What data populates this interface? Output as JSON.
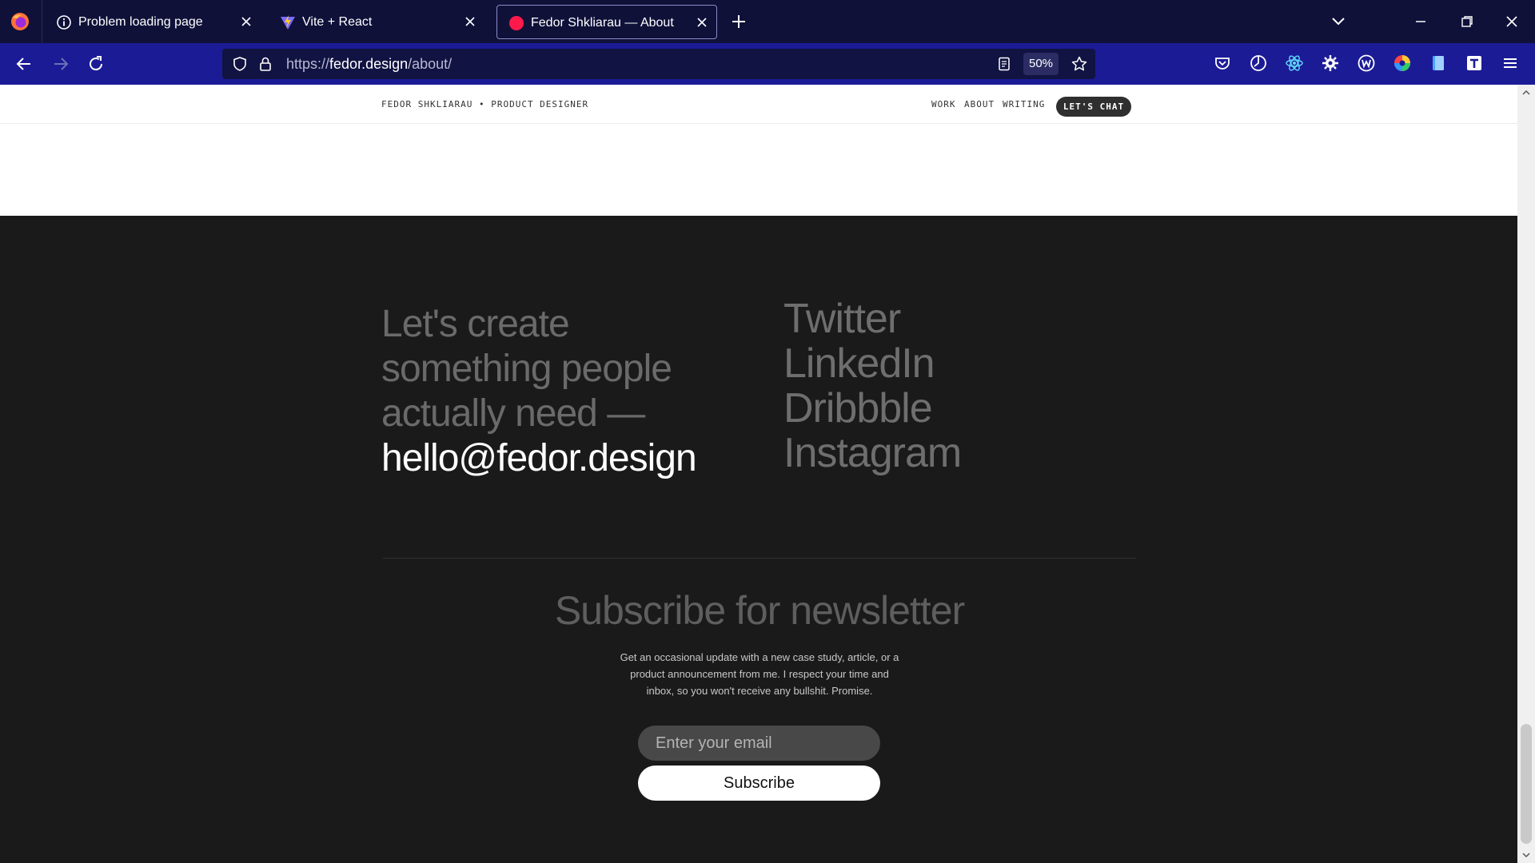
{
  "browser": {
    "tabs": [
      {
        "title": "Problem loading page",
        "icon": "info-icon",
        "active": false
      },
      {
        "title": "Vite + React",
        "icon": "vite-icon",
        "active": false
      },
      {
        "title": "Fedor Shkliarau — About",
        "icon": "favicon-dot-icon",
        "active": true
      }
    ],
    "url": {
      "scheme": "https://",
      "host": "fedor.design",
      "path": "/about/"
    },
    "zoom": "50%",
    "accent": "#1c1b96",
    "tabbar_color": "#0f1139"
  },
  "site": {
    "brand": "FEDOR SHKLIARAU • PRODUCT DESIGNER",
    "nav": [
      "WORK",
      "ABOUT",
      "WRITING"
    ],
    "cta_button": "LET'S CHAT"
  },
  "footer": {
    "cta_line1": "Let's create",
    "cta_line2": "something people",
    "cta_line3": "actually need —",
    "email": "hello@fedor.design",
    "socials": [
      "Twitter",
      "LinkedIn",
      "Dribbble",
      "Instagram"
    ],
    "newsletter": {
      "title": "Subscribe for newsletter",
      "description": "Get an occasional update with a new case study, article, or a product announcement from me. I respect your time and inbox, so you won't receive any bullshit. Promise.",
      "placeholder": "Enter your email",
      "button": "Subscribe"
    }
  }
}
